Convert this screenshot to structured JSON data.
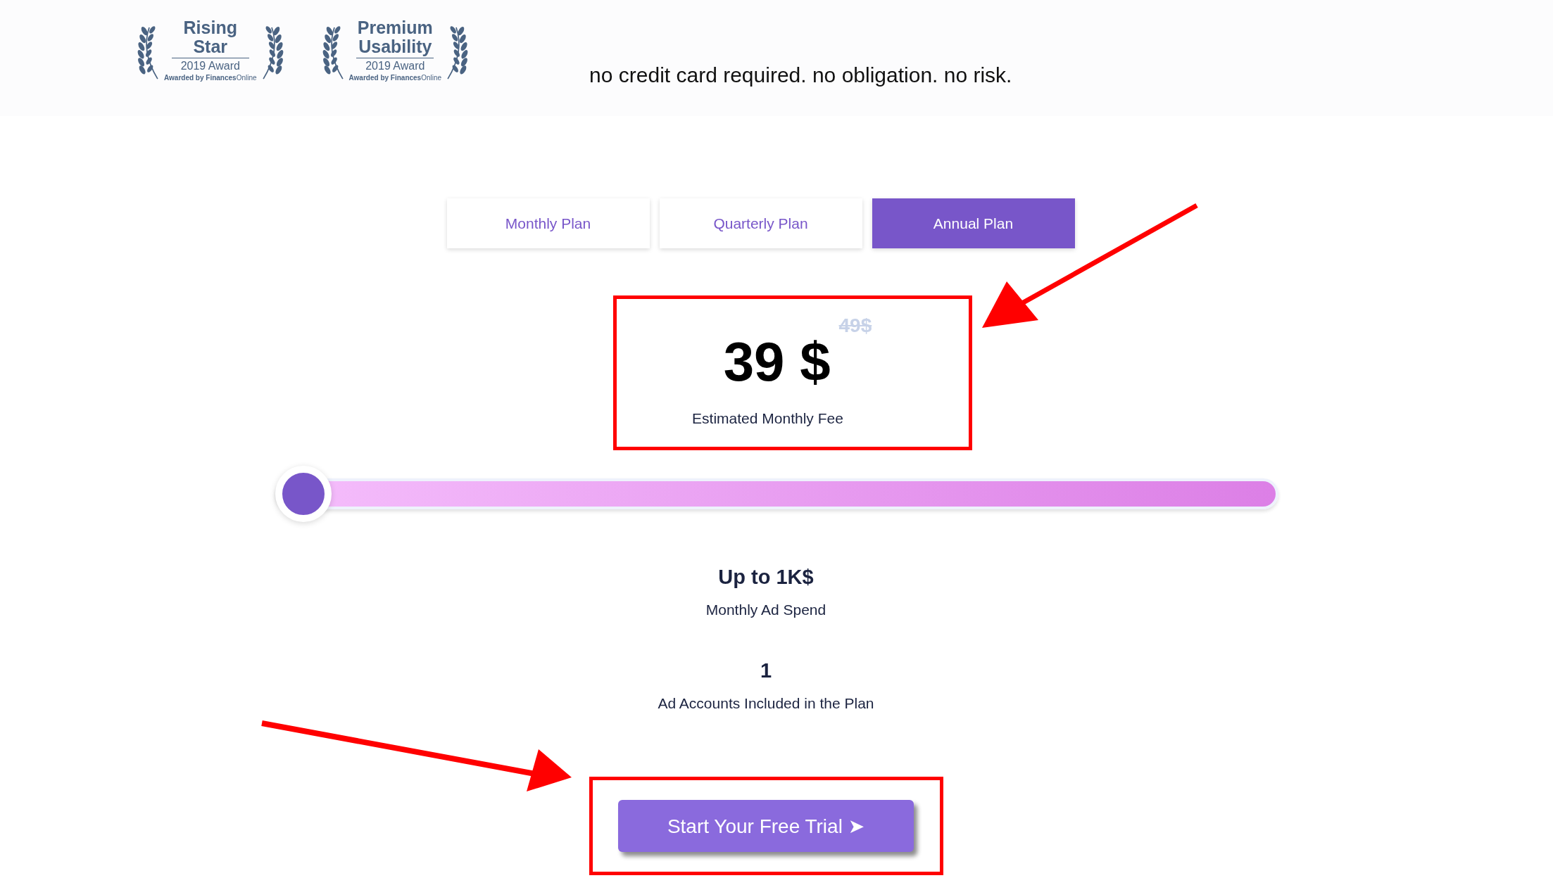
{
  "awards": [
    {
      "title": "Rising Star",
      "subtitle": "2019 Award",
      "awarded_by": "**Awarded by Finances**Online"
    },
    {
      "title": "Premium Usability",
      "subtitle": "2019 Award",
      "awarded_by": "**Awarded by Finances**Online"
    }
  ],
  "tagline": "no credit card required. no obligation. no risk.",
  "tabs": [
    {
      "label": "Monthly Plan",
      "selected": false
    },
    {
      "label": "Quarterly Plan",
      "selected": false
    },
    {
      "label": "Annual Plan",
      "selected": true
    }
  ],
  "price": {
    "amount": "39 $",
    "old_amount": "49$",
    "caption": "Estimated Monthly Fee"
  },
  "slider": {
    "level": 0
  },
  "stats": [
    {
      "value": "Up to 1K$",
      "label": "Monthly Ad Spend"
    },
    {
      "value": "1",
      "label": "Ad Accounts Included in the Plan"
    }
  ],
  "cta": {
    "label": "Start Your Free Trial ➤"
  }
}
